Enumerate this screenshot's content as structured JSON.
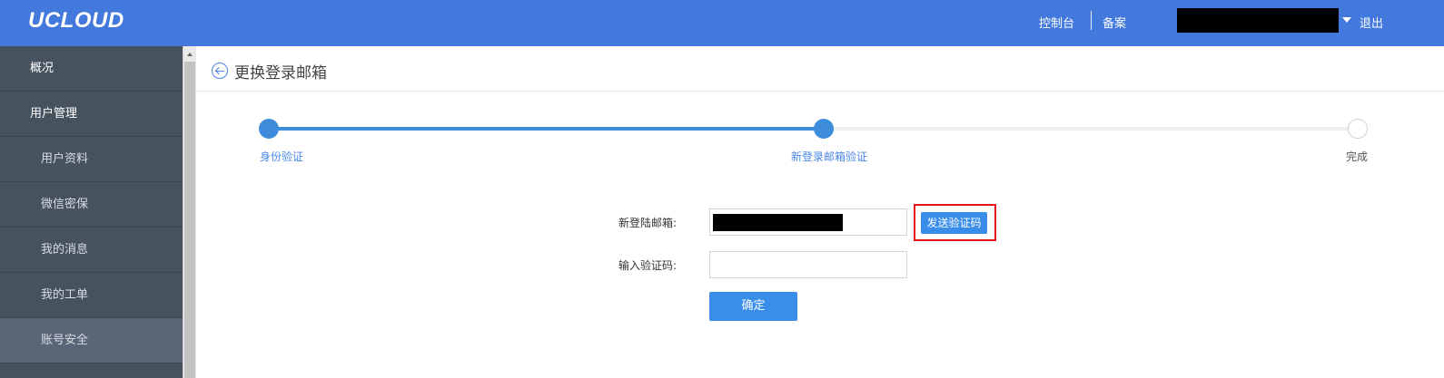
{
  "brand": {
    "logo": "UCLOUD"
  },
  "topnav": {
    "console": "控制台",
    "filing": "备案",
    "logout": "退出"
  },
  "sidebar": {
    "items": [
      {
        "label": "概况"
      },
      {
        "label": "用户管理"
      },
      {
        "label": "用户资料"
      },
      {
        "label": "微信密保"
      },
      {
        "label": "我的消息"
      },
      {
        "label": "我的工单"
      },
      {
        "label": "账号安全"
      }
    ]
  },
  "page": {
    "title": "更换登录邮箱"
  },
  "steps": [
    {
      "label": "身份验证"
    },
    {
      "label": "新登录邮箱验证"
    },
    {
      "label": "完成"
    }
  ],
  "form": {
    "email_label": "新登陆邮箱:",
    "code_label": "输入验证码:",
    "send_code": "发送验证码",
    "confirm": "确定"
  },
  "colors": {
    "topbar": "#4378dd",
    "sidebar": "#47525f",
    "primary": "#3b8dea",
    "highlight": "#e3151a"
  }
}
